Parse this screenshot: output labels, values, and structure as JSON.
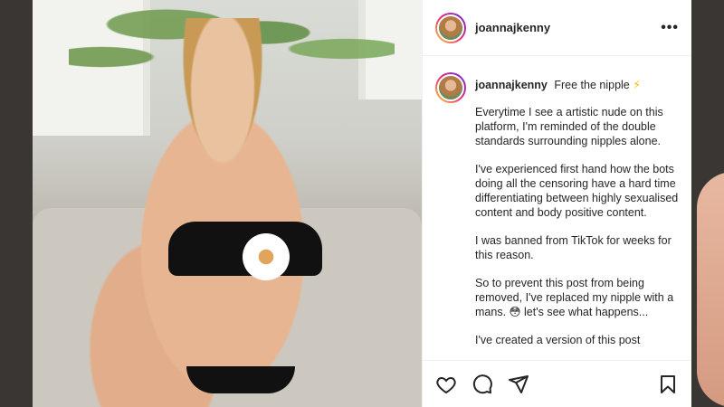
{
  "post": {
    "username": "joannajkenny",
    "caption": {
      "username": "joannajkenny",
      "headline": "Free the nipple",
      "headline_icon": "⚡",
      "paragraphs": [
        "Everytime I see a artistic nude on this platform, I'm reminded of the double standards surrounding nipples alone.",
        "I've experienced first hand how the bots doing all the censoring have a hard time differentiating between highly sexualised content and body positive content.",
        "I was banned from TikTok for weeks for this reason.",
        "So to prevent this post from being removed, I've replaced my nipple with a mans. 😳 let's see what happens...",
        "I've created a version of this post"
      ]
    },
    "icons": {
      "more": "more-options-icon",
      "like": "heart-icon",
      "comment": "comment-icon",
      "share": "send-icon",
      "save": "bookmark-icon"
    },
    "more_glyph": "•••"
  }
}
